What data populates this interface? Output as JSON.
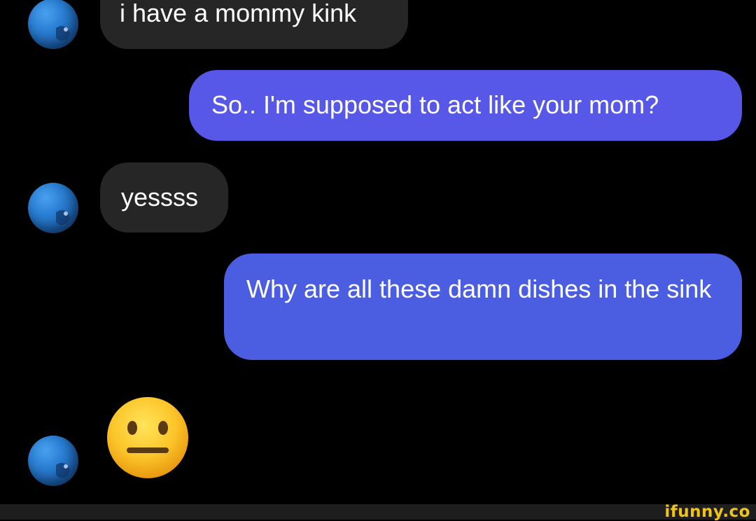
{
  "messages": [
    {
      "direction": "incoming",
      "text": "i have a mommy kink"
    },
    {
      "direction": "outgoing",
      "text": "So.. I'm supposed to act like your mom?"
    },
    {
      "direction": "incoming",
      "text": "yessss"
    },
    {
      "direction": "outgoing",
      "text": "Why are all these damn dishes in the sink"
    },
    {
      "direction": "incoming",
      "emoji": "neutral-face"
    }
  ],
  "colors": {
    "background": "#000000",
    "incoming_bubble": "#262626",
    "outgoing_bubble_1": "#5757e8",
    "outgoing_bubble_2": "#4b5ee2",
    "avatar": "#2a7fd4",
    "watermark": "#f0c417"
  },
  "watermark": "ifunny.co"
}
